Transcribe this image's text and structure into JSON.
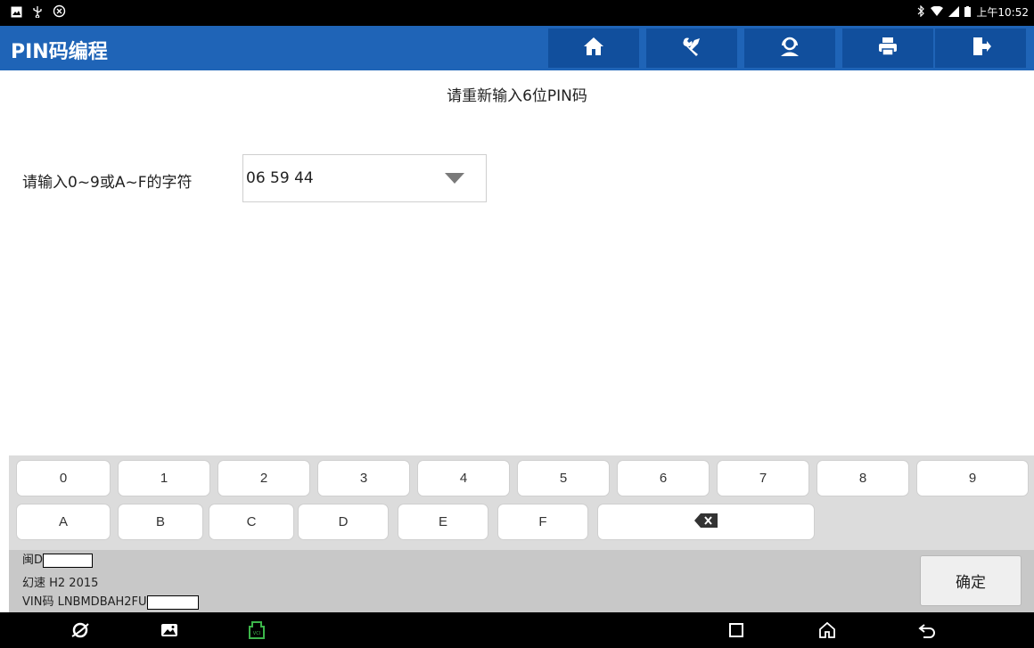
{
  "status_bar": {
    "left_icons": [
      "image-icon",
      "usb-icon",
      "settings-badge-icon"
    ],
    "right_icons": [
      "bluetooth-icon",
      "wifi-icon",
      "signal-icon",
      "battery-icon"
    ],
    "time": "上午10:52"
  },
  "header": {
    "title": "PIN码编程",
    "buttons": [
      "home-icon",
      "tools-icon",
      "support-icon",
      "print-icon",
      "exit-icon"
    ]
  },
  "main": {
    "prompt": "请重新输入6位PIN码",
    "field_label": "请输入0~9或A~F的字符",
    "field_value": "06 59 44"
  },
  "keyboard": {
    "row1": [
      "0",
      "1",
      "2",
      "3",
      "4",
      "5",
      "6",
      "7",
      "8",
      "9"
    ],
    "row2": [
      "A",
      "B",
      "C",
      "D",
      "E",
      "F"
    ],
    "backspace": "backspace-icon"
  },
  "footer": {
    "line1": "闽D",
    "line2": "幻速 H2 2015",
    "line3": "VIN码 LNBMDBAH2FU",
    "ok_label": "确定"
  },
  "nav_bar": {
    "icons": [
      "browser-icon",
      "gallery-icon",
      "vci-icon",
      "recents-icon",
      "home-icon",
      "back-icon"
    ]
  },
  "colors": {
    "title_bar": "#1f64b7",
    "title_button": "#114f9d",
    "keyboard_bg": "#dcdcdc",
    "footer_bg": "#c8c8c8",
    "vci_icon": "#3cb54a"
  }
}
